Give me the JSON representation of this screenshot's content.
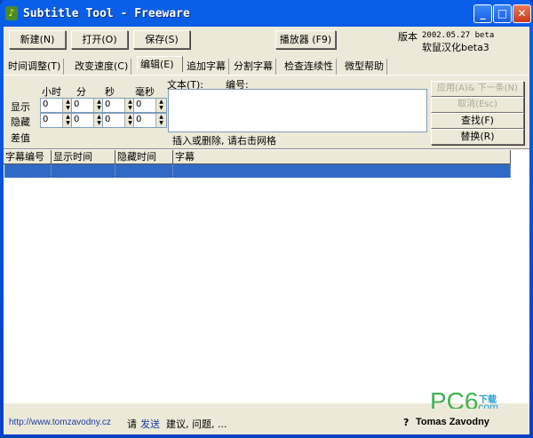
{
  "window": {
    "title": "Subtitle Tool - Freeware",
    "min": "_",
    "max": "□",
    "close": "✕"
  },
  "toolbar": {
    "new": "新建(N)",
    "open": "打开(O)",
    "save": "保存(S)",
    "player": "播放器 (F9)",
    "version_label": "版本",
    "version": "2002.05.27 beta",
    "localization": "软鼠汉化beta3"
  },
  "tabs": [
    {
      "label": "时间调整(T)"
    },
    {
      "label": "改变速度(C)"
    },
    {
      "label": "编辑(E)"
    },
    {
      "label": "追加字幕"
    },
    {
      "label": "分割字幕"
    },
    {
      "label": "检查连续性"
    },
    {
      "label": "微型帮助"
    }
  ],
  "edit": {
    "hour": "小时",
    "min": "分",
    "sec": "秒",
    "ms": "毫秒",
    "show": "显示",
    "hide": "隐藏",
    "diff": "差值",
    "text_label": "文本(T):",
    "number_label": "编号:",
    "hint": "插入或删除, 请右击网格",
    "show_values": [
      "0",
      "0",
      "0",
      "0"
    ],
    "hide_values": [
      "0",
      "0",
      "0",
      "0"
    ],
    "apply": "应用(A)& 下一条(N)",
    "cancel": "取消(Esc)",
    "find": "查找(F)",
    "replace": "替换(R)"
  },
  "grid": {
    "columns": [
      "字幕编号",
      "显示时间",
      "隐藏时间",
      "字幕"
    ]
  },
  "status": {
    "url": "http://www.tomzavodny.cz",
    "please": "请",
    "send": "发送",
    "rest": "建议, 问题, ...",
    "help": "?",
    "author": "Tomas Zavodny"
  },
  "watermark": {
    "text": "PC6",
    "sub1": "下载",
    "sub2": ".com"
  }
}
